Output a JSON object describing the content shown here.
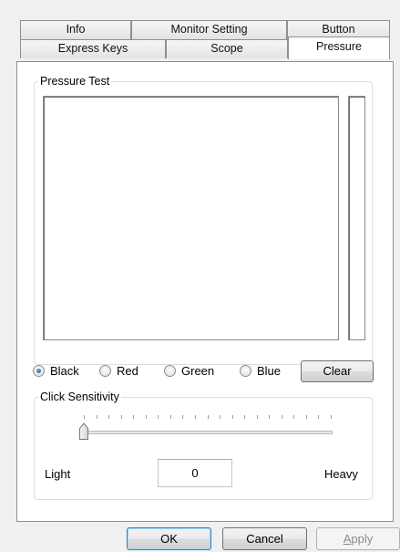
{
  "tabs": {
    "row_back": [
      "Info",
      "Monitor Setting",
      "Button"
    ],
    "row_front": [
      "Express Keys",
      "Scope",
      "Pressure"
    ],
    "active": "Pressure"
  },
  "pressure_test": {
    "legend": "Pressure Test"
  },
  "colors": {
    "options": [
      "Black",
      "Red",
      "Green",
      "Blue"
    ],
    "selected": "Black",
    "clear_label": "Clear"
  },
  "click_sensitivity": {
    "legend": "Click Sensitivity",
    "min_label": "Light",
    "max_label": "Heavy",
    "value": "0",
    "level": 0
  },
  "dialog_buttons": {
    "ok": "OK",
    "cancel": "Cancel",
    "apply": "Apply"
  },
  "theme": {
    "window_bg": "#f0f0f0",
    "panel_bg": "#ffffff",
    "default_button_border": "#3c7fb1",
    "radio_selected": "#1a4f9b"
  }
}
